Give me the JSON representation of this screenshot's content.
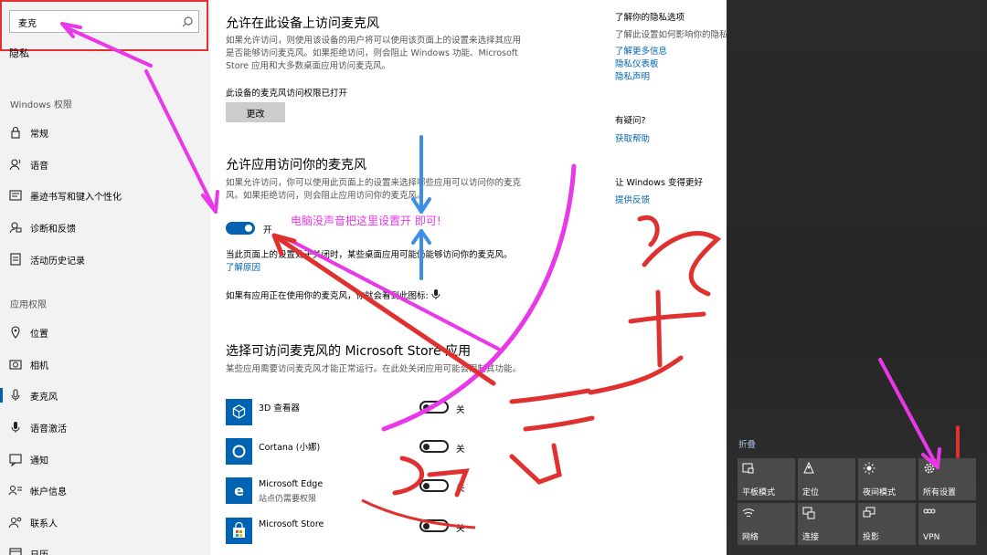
{
  "sidebar": {
    "search_value": "麦克",
    "heading": "隐私",
    "group_windows": "Windows 权限",
    "group_app": "应用权限",
    "items": [
      {
        "label": "常规",
        "icon": "lock-icon"
      },
      {
        "label": "语音",
        "icon": "speech-icon"
      },
      {
        "label": "墨迹书写和键入个性化",
        "icon": "ink-icon"
      },
      {
        "label": "诊断和反馈",
        "icon": "feedback-icon"
      },
      {
        "label": "活动历史记录",
        "icon": "history-icon"
      },
      {
        "label": "位置",
        "icon": "location-icon"
      },
      {
        "label": "相机",
        "icon": "camera-icon"
      },
      {
        "label": "麦克风",
        "icon": "microphone-icon"
      },
      {
        "label": "语音激活",
        "icon": "voice-activation-icon"
      },
      {
        "label": "通知",
        "icon": "notification-icon"
      },
      {
        "label": "帐户信息",
        "icon": "account-icon"
      },
      {
        "label": "联系人",
        "icon": "contacts-icon"
      },
      {
        "label": "日历",
        "icon": "calendar-icon"
      }
    ]
  },
  "main": {
    "s1_title": "允许在此设备上访问麦克风",
    "s1_desc": "如果允许访问，则使用该设备的用户将可以使用该页面上的设置来选择其应用是否能够访问麦克风。如果拒绝访问，则会阻止 Windows 功能、Microsoft Store 应用和大多数桌面应用访问麦克风。",
    "s1_status": "此设备的麦克风访问权限已打开",
    "s1_button": "更改",
    "s2_title": "允许应用访问你的麦克风",
    "s2_desc": "如果允许访问，你可以使用此页面上的设置来选择哪些应用可以访问你的麦克风。如果拒绝访问，则会阻止应用访问你的麦克风。",
    "s2_toggle_label": "开",
    "s2_note": "当此页面上的设置处于关闭时，某些桌面应用可能仍能够访问你的麦克风。",
    "s2_link": "了解原因",
    "s2_icon_note": "如果有应用正在使用你的麦克风，你就会看到此图标:",
    "s3_title": "选择可访问麦克风的 Microsoft Store 应用",
    "s3_desc": "某些应用需要访问麦克风才能正常运行。在此处关闭应用可能会限制其功能。",
    "apps": [
      {
        "name": "3D 查看器",
        "sub": "",
        "state": "关",
        "icon": "3d-viewer-icon"
      },
      {
        "name": "Cortana (小娜)",
        "sub": "",
        "state": "关",
        "icon": "cortana-icon"
      },
      {
        "name": "Microsoft Edge",
        "sub": "站点仍需要权限",
        "state": "关",
        "icon": "edge-icon"
      },
      {
        "name": "Microsoft Store",
        "sub": "",
        "state": "关",
        "icon": "store-icon"
      }
    ]
  },
  "right": {
    "privacy_title": "了解你的隐私选项",
    "privacy_desc": "了解此设置如何影响你的隐私。",
    "link_more": "了解更多信息",
    "link_dashboard": "隐私仪表板",
    "link_statement": "隐私声明",
    "question": "有疑问?",
    "link_help": "获取帮助",
    "better_title": "让 Windows 变得更好",
    "link_feedback": "提供反馈"
  },
  "action_center": {
    "collapse": "折叠",
    "tiles": [
      {
        "label": "平板模式",
        "icon": "tablet-mode-icon"
      },
      {
        "label": "定位",
        "icon": "location-icon"
      },
      {
        "label": "夜间模式",
        "icon": "night-light-icon"
      },
      {
        "label": "所有设置",
        "icon": "gear-icon"
      },
      {
        "label": "网络",
        "icon": "network-icon"
      },
      {
        "label": "连接",
        "icon": "connect-icon"
      },
      {
        "label": "投影",
        "icon": "project-icon"
      },
      {
        "label": "VPN",
        "icon": "vpn-icon"
      }
    ]
  },
  "annotation": {
    "hint": "电脑没声音把这里设置开  即可!",
    "colors": {
      "magenta": "#e838e8",
      "red": "#e03131",
      "blue": "#3b8ee6",
      "accent": "#0063b1"
    }
  }
}
